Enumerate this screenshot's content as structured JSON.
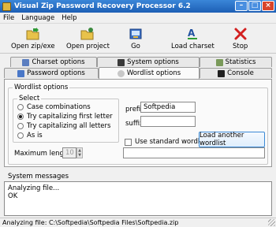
{
  "window": {
    "title": "Visual Zip Password Recovery Processor 6.2"
  },
  "menu": {
    "items": [
      "File",
      "Language",
      "Help"
    ]
  },
  "toolbar": {
    "open_zip": "Open zip/exe",
    "open_project": "Open project",
    "go": "Go",
    "load_charset": "Load charset",
    "stop": "Stop"
  },
  "tabs": {
    "charset": "Charset options",
    "system": "System options",
    "statistics": "Statistics",
    "password": "Password options",
    "wordlist": "Wordlist options",
    "console": "Console"
  },
  "wordlist": {
    "group_label": "Wordlist options",
    "select_label": "Select",
    "options": [
      "Case combinations",
      "Try capitalizing first letter",
      "Try capitalizing all letters",
      "As is"
    ],
    "selected_index": 1,
    "max_length_label": "Maximum length",
    "max_length_value": "10",
    "prefix_label": "prefix",
    "prefix_value": "Softpedia",
    "suffix_label": "suffix",
    "suffix_value": "",
    "use_standard_label": "Use standard wordlist",
    "load_button": "Load another wordlist"
  },
  "system_messages": {
    "label": "System messages",
    "lines": [
      "Analyzing file...",
      "OK"
    ]
  },
  "status": {
    "text": "Analyzing file: C:\\Softpedia\\Softpedia Files\\Softpedia.zip"
  },
  "colors": {
    "title_bar": "#1d5fb5",
    "button_border": "#3b8ad6",
    "stop_icon": "#d32020"
  }
}
